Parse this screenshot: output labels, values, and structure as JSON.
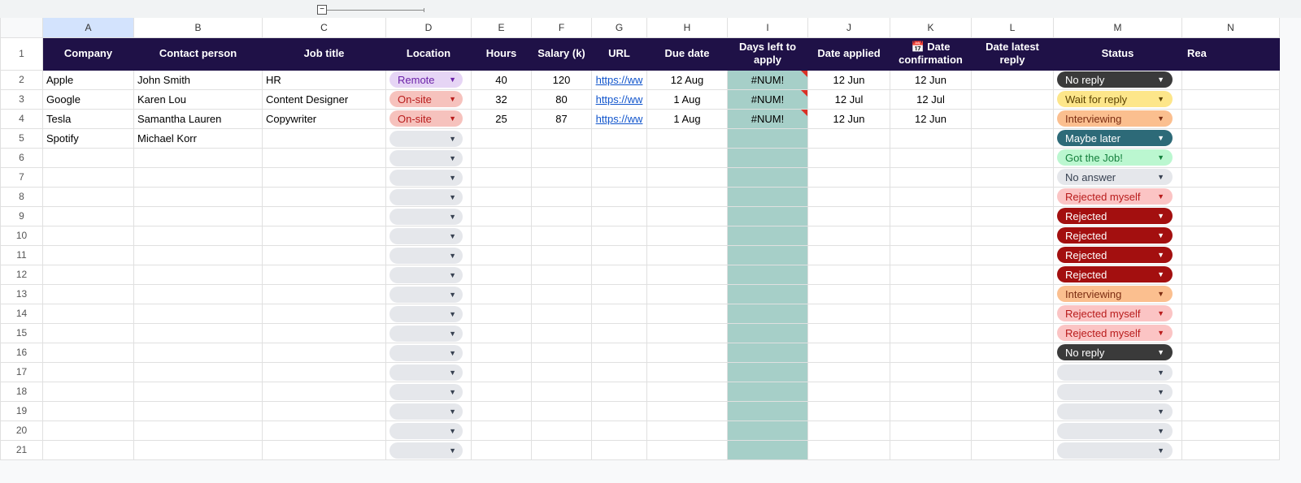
{
  "columns": [
    "A",
    "B",
    "C",
    "D",
    "E",
    "F",
    "G",
    "H",
    "I",
    "J",
    "K",
    "L",
    "M",
    "N"
  ],
  "last_col_header": "Rea",
  "headers": {
    "A": "Company",
    "B": "Contact person",
    "C": "Job title",
    "D": "Location",
    "E": "Hours",
    "F": "Salary (k)",
    "G": "URL",
    "H": "Due date",
    "I": "Days left to apply",
    "J": "Date applied",
    "K": "📅 Date confirmation",
    "L": "Date latest reply",
    "M": "Status"
  },
  "group_minus": "−",
  "pill_colors": {
    "Remote": {
      "bg": "#e6d5f5",
      "fg": "#6b21a8",
      "caret": "#6b21a8"
    },
    "On-site": {
      "bg": "#f6c2bd",
      "fg": "#b91c1c",
      "caret": "#b91c1c"
    },
    "empty-loc": {
      "bg": "#e5e7eb",
      "fg": "#374151",
      "caret": "#374151"
    },
    "No reply": {
      "bg": "#3a3a3a",
      "fg": "#ffffff",
      "caret": "#ffffff"
    },
    "Wait for reply": {
      "bg": "#fde68a",
      "fg": "#5c4303",
      "caret": "#5c4303"
    },
    "Interviewing": {
      "bg": "#fbbf8f",
      "fg": "#7c2d12",
      "caret": "#7c2d12"
    },
    "Maybe later": {
      "bg": "#2d6a78",
      "fg": "#ffffff",
      "caret": "#ffffff"
    },
    "Got the Job!": {
      "bg": "#bbf7d0",
      "fg": "#15803d",
      "caret": "#15803d"
    },
    "No answer": {
      "bg": "#e5e7eb",
      "fg": "#374151",
      "caret": "#374151"
    },
    "Rejected myself": {
      "bg": "#fbc4c4",
      "fg": "#b91c1c",
      "caret": "#b91c1c"
    },
    "Rejected": {
      "bg": "#a30f0f",
      "fg": "#ffffff",
      "caret": "#ffffff"
    },
    "empty-status": {
      "bg": "#e5e7eb",
      "fg": "#374151",
      "caret": "#374151"
    }
  },
  "rows": [
    {
      "n": 2,
      "A": "Apple",
      "B": "John Smith",
      "C": "HR",
      "D": "Remote",
      "E": "40",
      "F": "120",
      "G": "https://ww",
      "H": "12 Aug",
      "I": "#NUM!",
      "I_tri": true,
      "J": "12 Jun",
      "K": "12 Jun",
      "L": "",
      "M": "No reply"
    },
    {
      "n": 3,
      "A": "Google",
      "B": "Karen Lou",
      "C": "Content Designer",
      "D": "On-site",
      "E": "32",
      "F": "80",
      "G": "https://ww",
      "H": "1 Aug",
      "I": "#NUM!",
      "I_tri": true,
      "J": "12 Jul",
      "K": "12 Jul",
      "L": "",
      "M": "Wait for reply"
    },
    {
      "n": 4,
      "A": "Tesla",
      "B": "Samantha Lauren",
      "C": "Copywriter",
      "D": "On-site",
      "E": "25",
      "F": "87",
      "G": "https://ww",
      "H": "1 Aug",
      "I": "#NUM!",
      "I_tri": true,
      "J": "12 Jun",
      "K": "12 Jun",
      "L": "",
      "M": "Interviewing"
    },
    {
      "n": 5,
      "A": "Spotify",
      "B": "Michael Korr",
      "C": "",
      "D": "",
      "E": "",
      "F": "",
      "G": "",
      "H": "",
      "I": "",
      "J": "",
      "K": "",
      "L": "",
      "M": "Maybe later"
    },
    {
      "n": 6,
      "M": "Got the Job!"
    },
    {
      "n": 7,
      "M": "No answer"
    },
    {
      "n": 8,
      "M": "Rejected myself"
    },
    {
      "n": 9,
      "M": "Rejected"
    },
    {
      "n": 10,
      "M": "Rejected"
    },
    {
      "n": 11,
      "M": "Rejected"
    },
    {
      "n": 12,
      "M": "Rejected"
    },
    {
      "n": 13,
      "M": "Interviewing"
    },
    {
      "n": 14,
      "M": "Rejected myself"
    },
    {
      "n": 15,
      "M": "Rejected myself"
    },
    {
      "n": 16,
      "M": "No reply"
    },
    {
      "n": 17,
      "M": ""
    },
    {
      "n": 18,
      "M": ""
    },
    {
      "n": 19,
      "M": ""
    },
    {
      "n": 20,
      "M": ""
    },
    {
      "n": 21,
      "M": ""
    }
  ]
}
